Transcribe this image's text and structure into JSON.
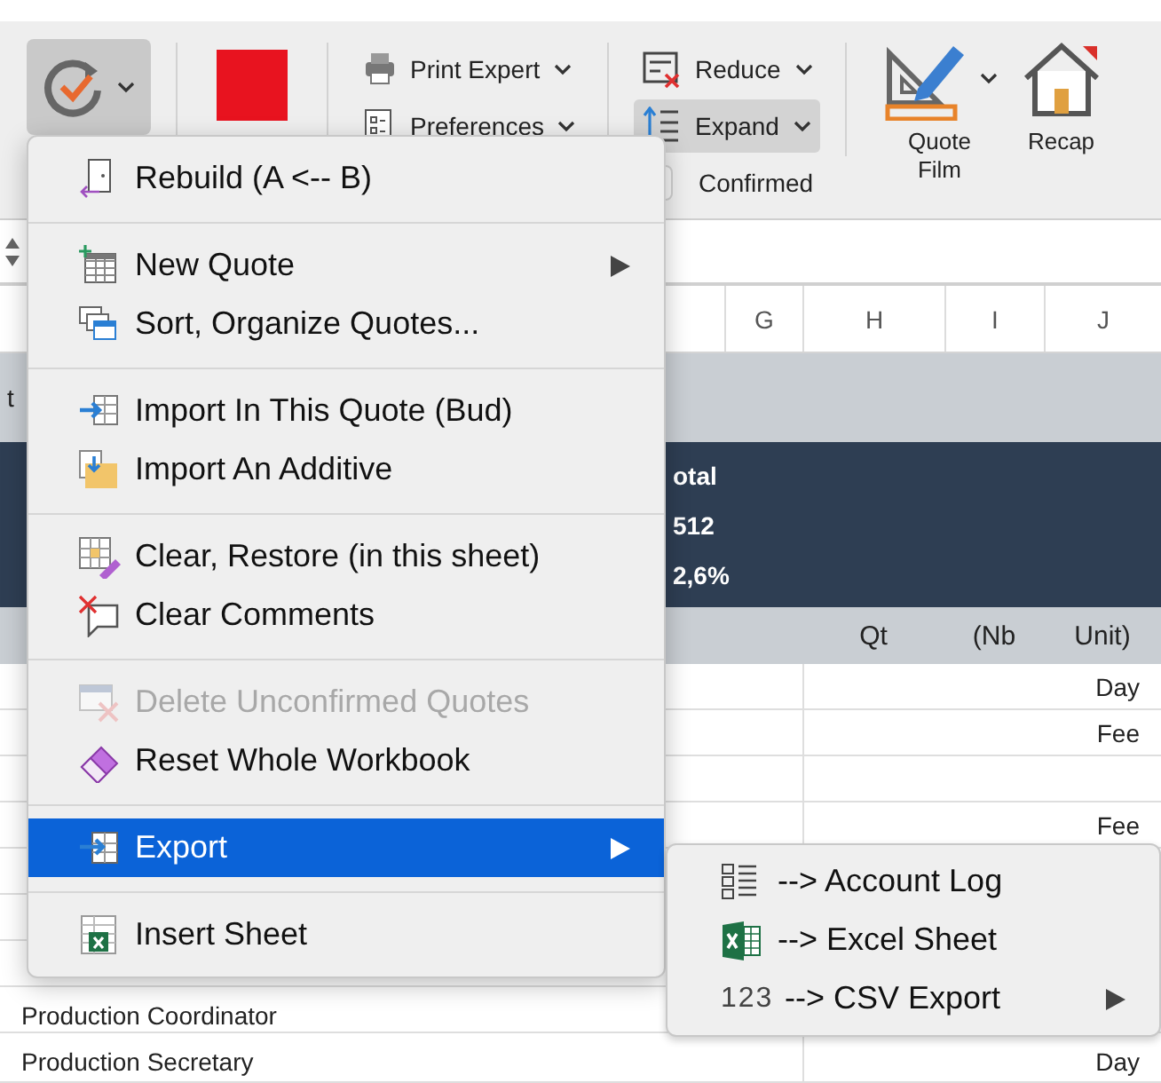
{
  "ribbon": {
    "main_button": {
      "pressed": true
    },
    "swatch": {
      "color": "#e8131f"
    },
    "print_group": [
      {
        "label": "Print Expert"
      },
      {
        "label": "Preferences"
      }
    ],
    "view_group": [
      {
        "label": "Reduce",
        "pressed": false
      },
      {
        "label": "Expand",
        "pressed": true
      }
    ],
    "confirmed": {
      "label": "Confirmed",
      "checked": false
    },
    "large_buttons": [
      {
        "label": "Quote\nFilm",
        "dropdown": true
      },
      {
        "label": "Recap",
        "dropdown": false
      }
    ]
  },
  "sheet": {
    "columns": [
      "G",
      "H",
      "I",
      "J"
    ],
    "band_label": "t",
    "summary": [
      "otal",
      "512",
      "2,6%"
    ],
    "header": [
      "Qt",
      "(Nb",
      "Unit)"
    ],
    "rows": [
      {
        "unit": "Day"
      },
      {
        "unit": "Fee"
      },
      {},
      {
        "unit": "Fee"
      },
      {},
      {},
      {},
      {
        "label": "Production Coordinator"
      },
      {
        "label": "Production Secretary",
        "unit": "Day"
      }
    ]
  },
  "menu": {
    "items": [
      {
        "kind": "item",
        "label": "Rebuild (A <-- B)",
        "disabled": false,
        "selected": false,
        "submenu": false
      },
      {
        "kind": "separator"
      },
      {
        "kind": "item",
        "label": "New Quote",
        "disabled": false,
        "selected": false,
        "submenu": true
      },
      {
        "kind": "item",
        "label": "Sort, Organize Quotes...",
        "disabled": false,
        "selected": false,
        "submenu": false
      },
      {
        "kind": "separator"
      },
      {
        "kind": "item",
        "label": "Import In This Quote (Bud)",
        "disabled": false,
        "selected": false,
        "submenu": false
      },
      {
        "kind": "item",
        "label": "Import An Additive",
        "disabled": false,
        "selected": false,
        "submenu": false
      },
      {
        "kind": "separator"
      },
      {
        "kind": "item",
        "label": "Clear, Restore (in this sheet)",
        "disabled": false,
        "selected": false,
        "submenu": false
      },
      {
        "kind": "item",
        "label": "Clear Comments",
        "disabled": false,
        "selected": false,
        "submenu": false
      },
      {
        "kind": "separator"
      },
      {
        "kind": "item",
        "label": "Delete Unconfirmed Quotes",
        "disabled": true,
        "selected": false,
        "submenu": false
      },
      {
        "kind": "item",
        "label": "Reset Whole Workbook",
        "disabled": false,
        "selected": false,
        "submenu": false
      },
      {
        "kind": "separator"
      },
      {
        "kind": "item",
        "label": "Export",
        "disabled": false,
        "selected": true,
        "submenu": true
      },
      {
        "kind": "separator"
      },
      {
        "kind": "item",
        "label": "Insert Sheet",
        "disabled": false,
        "selected": false,
        "submenu": false
      }
    ]
  },
  "submenu": {
    "items": [
      {
        "label": "--> Account Log",
        "selected": false,
        "submenu": false
      },
      {
        "label": "--> Excel Sheet",
        "selected": false,
        "submenu": false
      },
      {
        "label": "--> CSV Export",
        "icon_text": "123",
        "selected": false,
        "submenu": true
      }
    ]
  }
}
